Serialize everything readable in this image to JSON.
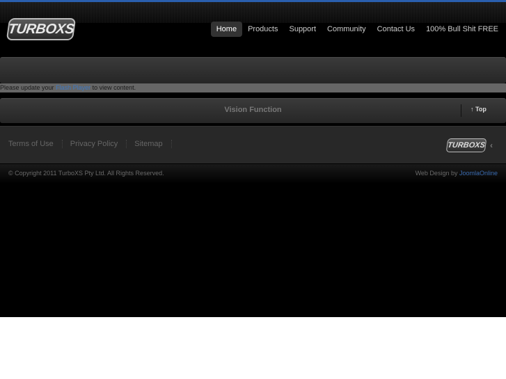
{
  "brand": {
    "logo_text": "TURBOXS",
    "accent": "#2a5fae"
  },
  "nav": {
    "items": [
      {
        "label": "Home",
        "active": true
      },
      {
        "label": "Products"
      },
      {
        "label": "Support"
      },
      {
        "label": "Community"
      },
      {
        "label": "Contact Us"
      },
      {
        "label": "100% Bull Shit FREE"
      }
    ]
  },
  "flash": {
    "prefix": "Please update your ",
    "link": "Flash Player",
    "suffix": " to view content."
  },
  "module": {
    "title": "Vision Function",
    "top_label": "Top",
    "top_icon": "↑"
  },
  "footer": {
    "links": [
      "Terms of Use",
      "Privacy Policy",
      "Sitemap"
    ],
    "logo_text": "TURBOXS",
    "chevron": "‹"
  },
  "copyright": {
    "text": "© Copyright 2011 TurboXS Pty Ltd. All Rights Reserved.",
    "credit_prefix": "Web Design by ",
    "credit_link": "JoomlaOnline"
  }
}
